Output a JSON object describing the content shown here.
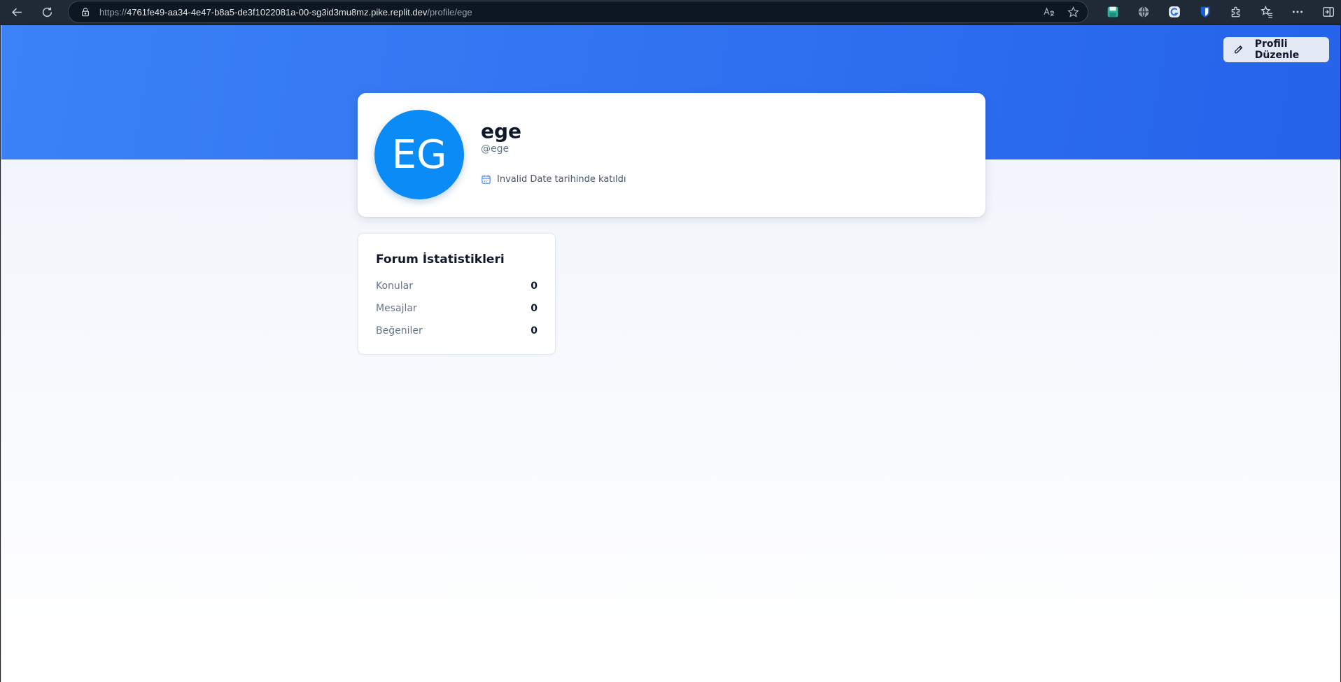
{
  "browser": {
    "url": {
      "scheme": "https://",
      "host": "4761fe49-aa34-4e47-b8a5-de3f1022081a-00-sg3id3mu8mz.pike.replit.dev",
      "path": "/profile/ege"
    },
    "icons": {
      "back": "back-arrow-icon",
      "refresh": "refresh-icon",
      "lock": "lock-icon",
      "read_aloud": "read-aloud-icon",
      "favorite": "star-icon",
      "extensions": [
        "save-extension-icon",
        "globe-extension-icon",
        "grammar-extension-icon",
        "bitwarden-extension-icon",
        "puzzle-icon",
        "favorites-icon",
        "more-icon",
        "sidebar-icon"
      ]
    }
  },
  "page": {
    "colors": {
      "hero_start": "#3b82f6",
      "hero_end": "#2563eb",
      "avatar": "#0a8bf5"
    },
    "edit_button": {
      "label": "Profili Düzenle",
      "icon": "pencil-icon"
    },
    "profile": {
      "initials": "EG",
      "display_name": "ege",
      "handle": "@ege",
      "joined_text": "Invalid Date tarihinde katıldı",
      "joined_icon": "calendar-icon"
    },
    "stats": {
      "title": "Forum İstatistikleri",
      "rows": [
        {
          "label": "Konular",
          "value": "0"
        },
        {
          "label": "Mesajlar",
          "value": "0"
        },
        {
          "label": "Beğeniler",
          "value": "0"
        }
      ]
    }
  }
}
